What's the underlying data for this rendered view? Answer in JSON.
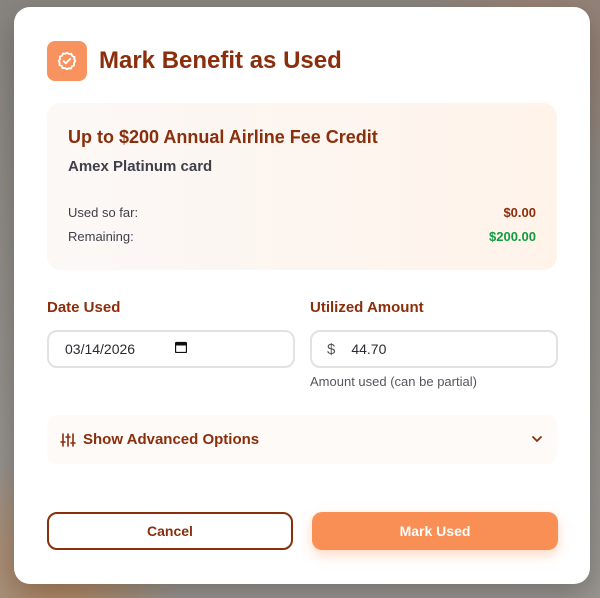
{
  "modal": {
    "title": "Mark Benefit as Used",
    "icon": "badge-check-icon",
    "accent_color": "#f89360",
    "title_color": "#8a2e0c"
  },
  "benefit": {
    "name": "Up to $200 Annual Airline Fee Credit",
    "card": "Amex Platinum card",
    "used_label": "Used so far:",
    "used_value": "$0.00",
    "remaining_label": "Remaining:",
    "remaining_value": "$200.00",
    "remaining_color": "#0f9d3f"
  },
  "form": {
    "date_label": "Date Used",
    "date_value": "03/14/2026",
    "amount_label": "Utilized Amount",
    "currency_symbol": "$",
    "amount_value": "44.70",
    "amount_hint": "Amount used (can be partial)"
  },
  "advanced": {
    "label": "Show Advanced Options",
    "icon": "sliders-icon",
    "toggle_icon": "chevron-down-icon"
  },
  "actions": {
    "cancel_label": "Cancel",
    "submit_label": "Mark Used",
    "submit_color": "#f98f54"
  }
}
